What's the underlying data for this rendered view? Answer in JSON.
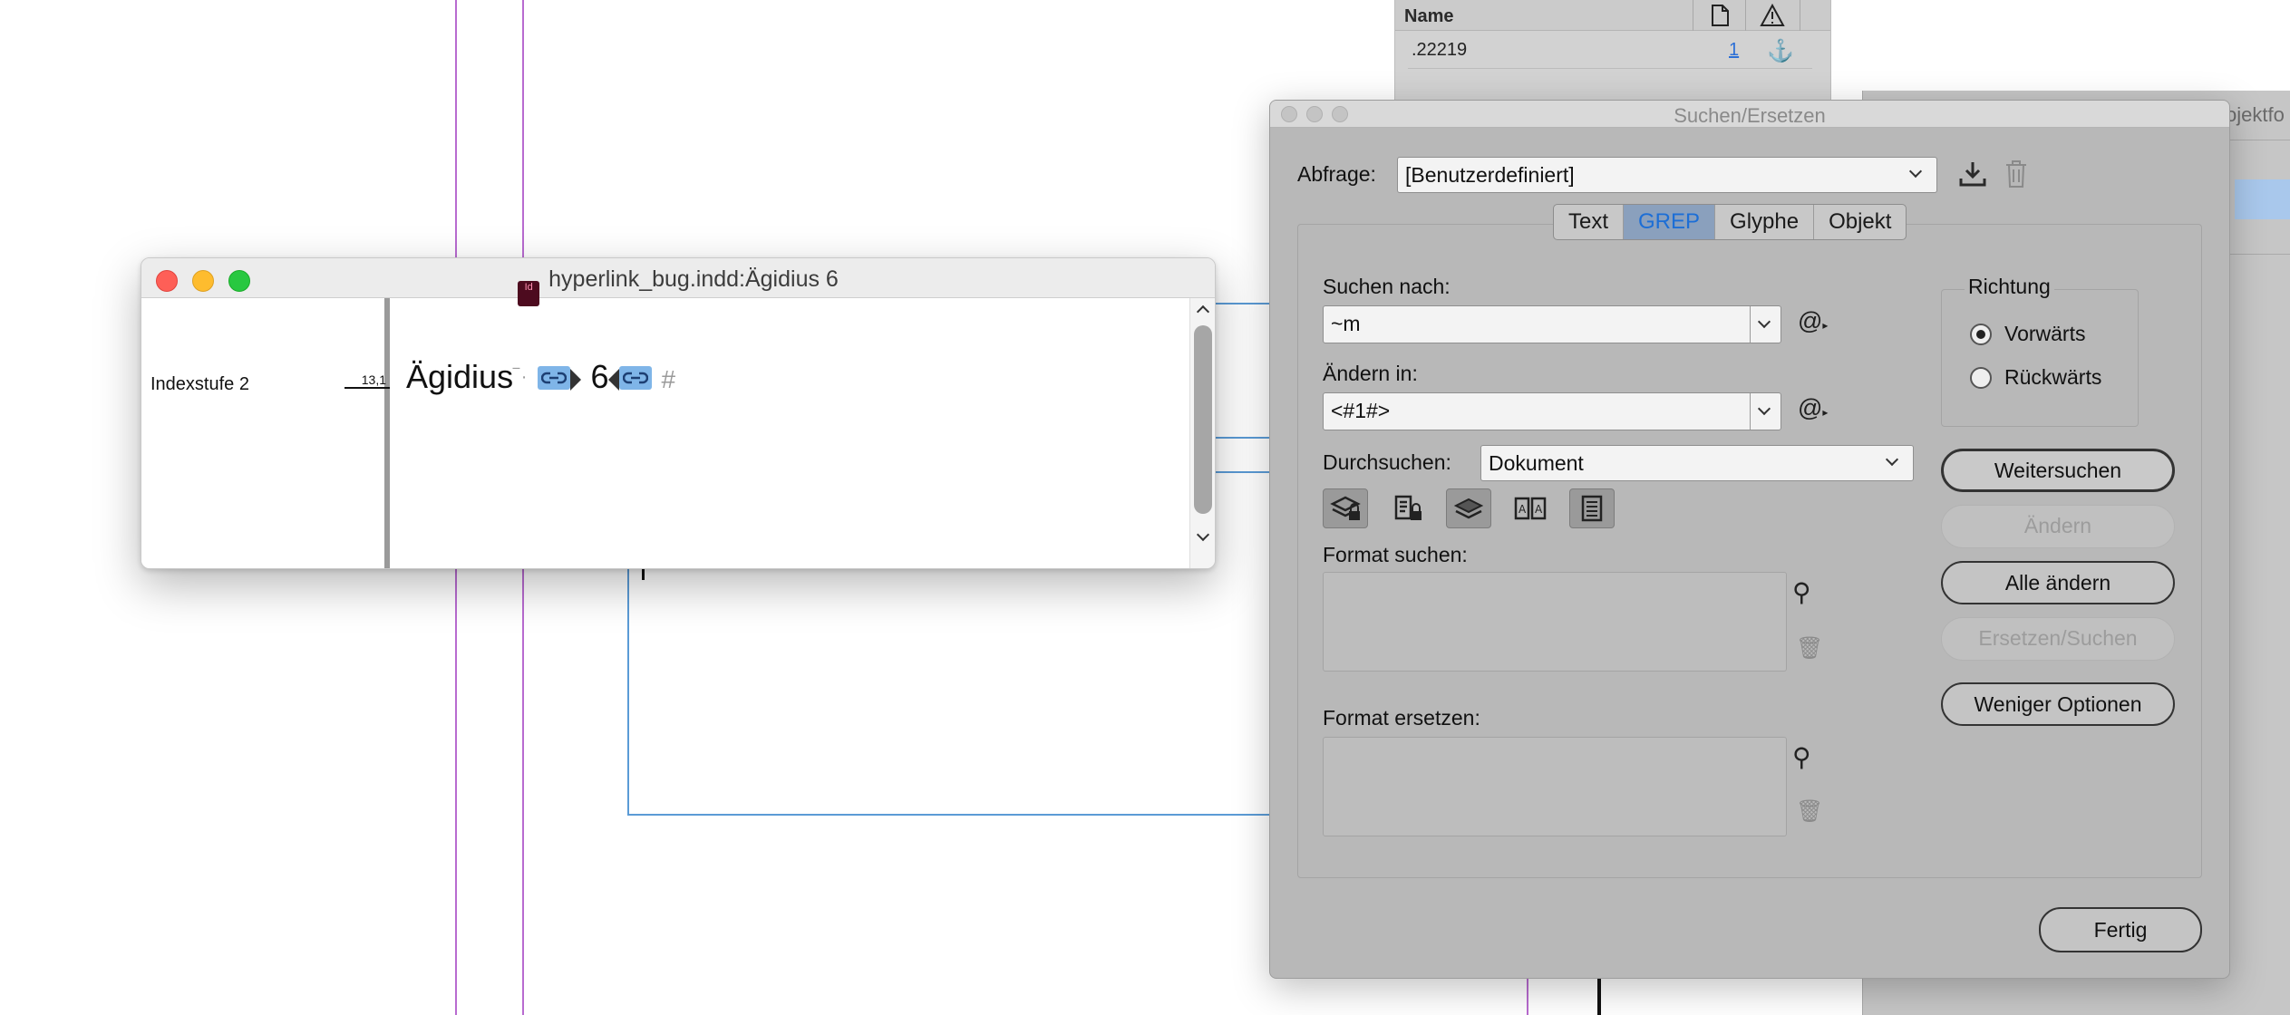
{
  "links_panel": {
    "header_name": "Name",
    "row": {
      "name": ".22219",
      "page": "1"
    }
  },
  "right_panel": {
    "title_fragment": "ojektfo"
  },
  "story_editor": {
    "window_title": "hyperlink_bug.indd:Ägidius 6",
    "app_icon_label": "Id",
    "style_name": "Indexstufe 2",
    "depth": "13,1",
    "text_word": "Ägidius",
    "text_number": "6",
    "text_end": "#"
  },
  "find_change": {
    "title": "Suchen/Ersetzen",
    "query_label": "Abfrage:",
    "query_value": "[Benutzerdefiniert]",
    "tabs": [
      "Text",
      "GREP",
      "Glyphe",
      "Objekt"
    ],
    "active_tab": "GREP",
    "find_label": "Suchen nach:",
    "find_value": "~m",
    "change_label": "Ändern in:",
    "change_value": "<#1#>",
    "search_label": "Durchsuchen:",
    "search_value": "Dokument",
    "find_format_label": "Format suchen:",
    "change_format_label": "Format ersetzen:",
    "direction_label": "Richtung",
    "direction_forward": "Vorwärts",
    "direction_backward": "Rückwärts",
    "direction_selected": "Vorwärts",
    "buttons": {
      "find_next": "Weitersuchen",
      "change": "Ändern",
      "change_all": "Alle ändern",
      "change_find": "Ersetzen/Suchen",
      "fewer_options": "Weniger Optionen",
      "done": "Fertig"
    },
    "special_char_symbol": "@"
  },
  "colors": {
    "guide": "#b86bd0",
    "frame": "#5b9bd6",
    "active_tab_text": "#1c6ed6",
    "hyperlink_marker": "#7fb5e8"
  }
}
